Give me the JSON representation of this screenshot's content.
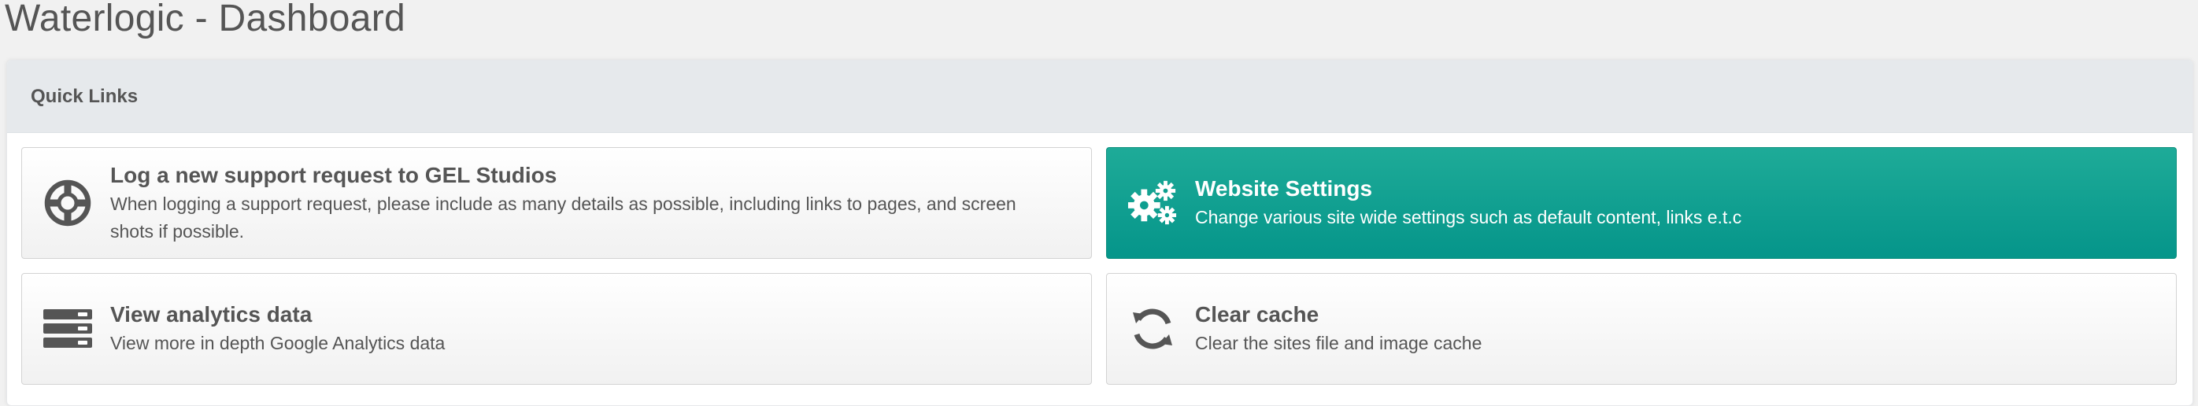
{
  "page": {
    "title": "Waterlogic - Dashboard"
  },
  "panel": {
    "heading": "Quick Links"
  },
  "tiles": [
    {
      "icon": "lifebuoy-icon",
      "title": "Log a new support request to GEL Studios",
      "description": "When logging a support request, please include as many details as possible, including links to pages, and screen shots if possible."
    },
    {
      "icon": "gears-icon",
      "title": "Website Settings",
      "description": "Change various site wide settings such as default content, links e.t.c",
      "active": true
    },
    {
      "icon": "server-icon",
      "title": "View analytics data",
      "description": "View more in depth Google Analytics data"
    },
    {
      "icon": "refresh-icon",
      "title": "Clear cache",
      "description": "Clear the sites file and image cache"
    }
  ],
  "colors": {
    "active_tile": "#0d9e8f",
    "text": "#555555",
    "header_bg": "#e6e9ec"
  }
}
